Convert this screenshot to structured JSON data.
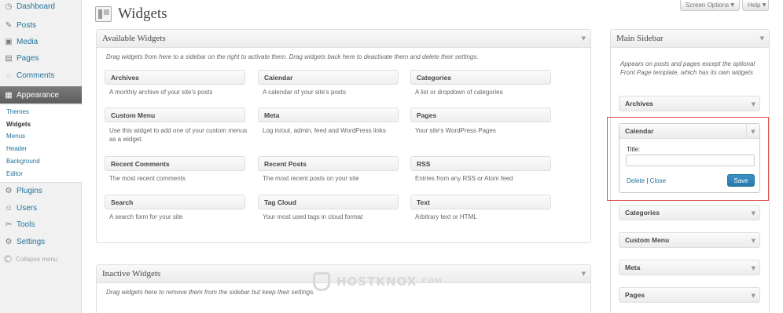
{
  "sidebar": {
    "items": [
      {
        "label": "Dashboard",
        "icon": "dashboard-icon"
      },
      {
        "label": "Posts",
        "icon": "pin-icon"
      },
      {
        "label": "Media",
        "icon": "media-icon"
      },
      {
        "label": "Pages",
        "icon": "page-icon"
      },
      {
        "label": "Comments",
        "icon": "comment-icon"
      },
      {
        "label": "Appearance",
        "icon": "appearance-icon"
      },
      {
        "label": "Plugins",
        "icon": "plugin-icon"
      },
      {
        "label": "Users",
        "icon": "users-icon"
      },
      {
        "label": "Tools",
        "icon": "tools-icon"
      },
      {
        "label": "Settings",
        "icon": "settings-icon"
      }
    ],
    "submenu": [
      "Themes",
      "Widgets",
      "Menus",
      "Header",
      "Background",
      "Editor"
    ],
    "collapse": "Collapse menu"
  },
  "header": {
    "title": "Widgets",
    "screen_options": "Screen Options",
    "help": "Help"
  },
  "available": {
    "title": "Available Widgets",
    "description": "Drag widgets from here to a sidebar on the right to activate them. Drag widgets back here to deactivate them and delete their settings.",
    "widgets": [
      {
        "name": "Archives",
        "desc": "A monthly archive of your site's posts"
      },
      {
        "name": "Calendar",
        "desc": "A calendar of your site's posts"
      },
      {
        "name": "Categories",
        "desc": "A list or dropdown of categories"
      },
      {
        "name": "Custom Menu",
        "desc": "Use this widget to add one of your custom menus as a widget."
      },
      {
        "name": "Meta",
        "desc": "Log in/out, admin, feed and WordPress links"
      },
      {
        "name": "Pages",
        "desc": "Your site's WordPress Pages"
      },
      {
        "name": "Recent Comments",
        "desc": "The most recent comments"
      },
      {
        "name": "Recent Posts",
        "desc": "The most recent posts on your site"
      },
      {
        "name": "RSS",
        "desc": "Entries from any RSS or Atom feed"
      },
      {
        "name": "Search",
        "desc": "A search form for your site"
      },
      {
        "name": "Tag Cloud",
        "desc": "Your most used tags in cloud format"
      },
      {
        "name": "Text",
        "desc": "Arbitrary text or HTML"
      }
    ]
  },
  "inactive": {
    "title": "Inactive Widgets",
    "description": "Drag widgets here to remove them from the sidebar but keep their settings."
  },
  "main_sidebar": {
    "title": "Main Sidebar",
    "description": "Appears on posts and pages except the optional Front Page template, which has its own widgets",
    "widgets": [
      "Archives",
      "Categories",
      "Custom Menu",
      "Meta",
      "Pages"
    ],
    "open_widget": {
      "name": "Calendar",
      "title_label": "Title:",
      "title_value": "",
      "delete": "Delete",
      "separator": "|",
      "close": "Close",
      "save": "Save"
    }
  },
  "watermark": {
    "text": "HOSTKNOX",
    "suffix": ".COM"
  },
  "colors": {
    "accent": "#21759b",
    "highlight": "#d9534f",
    "current_menu": "#6d6d6d"
  }
}
